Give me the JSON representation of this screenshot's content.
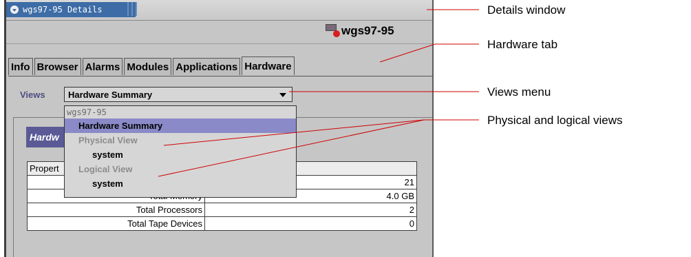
{
  "window": {
    "title": "wgs97-95 Details",
    "host_name": "wgs97-95"
  },
  "tabs": [
    {
      "label": "Info",
      "active": false
    },
    {
      "label": "Browser",
      "active": false
    },
    {
      "label": "Alarms",
      "active": false
    },
    {
      "label": "Modules",
      "active": false
    },
    {
      "label": "Applications",
      "active": false
    },
    {
      "label": "Hardware",
      "active": true
    }
  ],
  "views": {
    "label": "Views",
    "selected": "Hardware Summary",
    "options": {
      "host": "wgs97-95",
      "summary": "Hardware Summary",
      "physical": "Physical View",
      "physical_system": "system",
      "logical": "Logical View",
      "logical_system": "system"
    }
  },
  "section": {
    "title_partial": "Hardw"
  },
  "table": {
    "header_partial": "Propert",
    "rows": [
      {
        "key": "",
        "value": "21"
      },
      {
        "key": "Total Memory",
        "value": "4.0 GB"
      },
      {
        "key": "Total Processors",
        "value": "2"
      },
      {
        "key": "Total Tape Devices",
        "value": "0"
      }
    ]
  },
  "callouts": {
    "details_window": "Details window",
    "hardware_tab": "Hardware tab",
    "views_menu": "Views menu",
    "physical_logical": "Physical and logical views"
  },
  "colors": {
    "window_bg": "#c6c6c6",
    "titlebar_accent": "#3d6ca6",
    "selection": "#8a8ac8",
    "callout_line": "#d00000",
    "alarm": "#d81e1e"
  }
}
